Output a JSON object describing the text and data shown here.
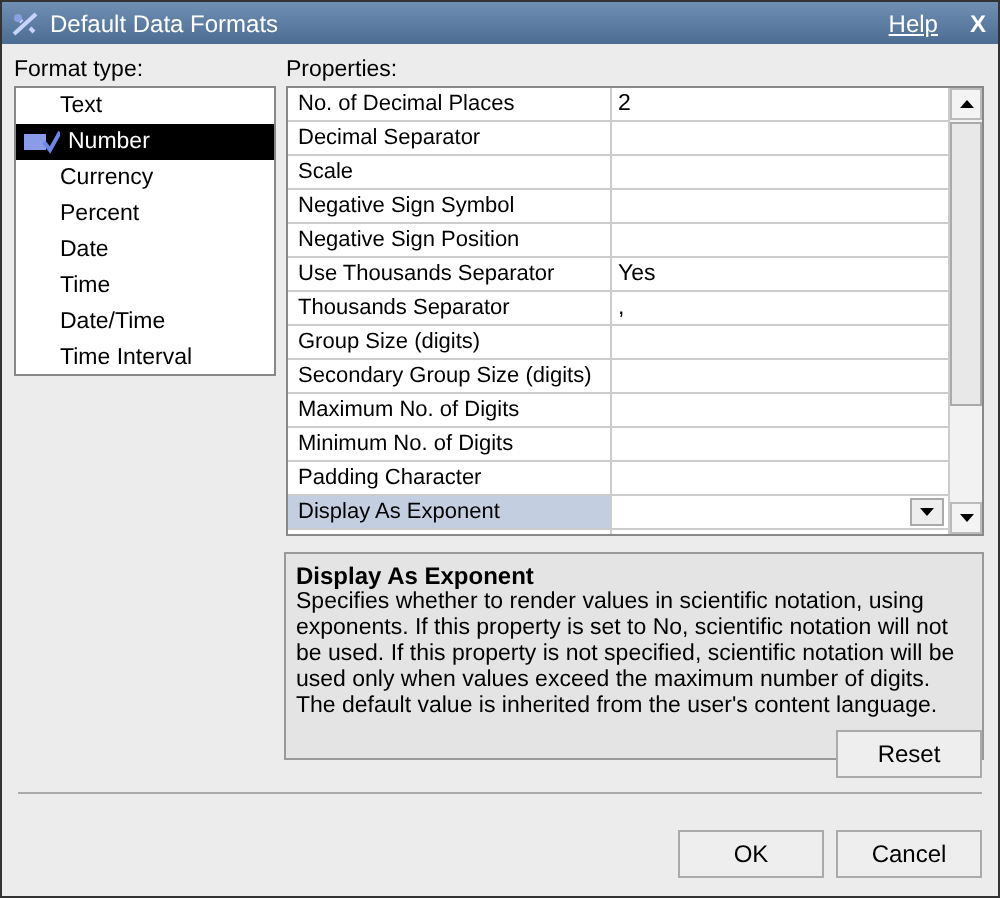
{
  "window": {
    "title": "Default Data Formats",
    "help": "Help",
    "close": "X"
  },
  "format_type": {
    "label": "Format type:",
    "items": [
      {
        "label": "Text",
        "selected": false
      },
      {
        "label": "Number",
        "selected": true
      },
      {
        "label": "Currency",
        "selected": false
      },
      {
        "label": "Percent",
        "selected": false
      },
      {
        "label": "Date",
        "selected": false
      },
      {
        "label": "Time",
        "selected": false
      },
      {
        "label": "Date/Time",
        "selected": false
      },
      {
        "label": "Time Interval",
        "selected": false
      }
    ]
  },
  "properties": {
    "label": "Properties:",
    "rows": [
      {
        "name": "No. of Decimal Places",
        "value": "2",
        "selected": false
      },
      {
        "name": "Decimal Separator",
        "selected": false
      },
      {
        "name": "Scale",
        "selected": false
      },
      {
        "name": "Negative Sign Symbol",
        "selected": false
      },
      {
        "name": "Negative Sign Position",
        "selected": false
      },
      {
        "name": "Use Thousands Separator",
        "value": "Yes",
        "selected": false
      },
      {
        "name": "Thousands Separator",
        "value": ",",
        "selected": false
      },
      {
        "name": "Group Size (digits)",
        "selected": false
      },
      {
        "name": "Secondary Group Size (digits)",
        "selected": false
      },
      {
        "name": "Maximum No. of Digits",
        "selected": false
      },
      {
        "name": "Minimum No. of Digits",
        "selected": false
      },
      {
        "name": "Padding Character",
        "selected": false
      },
      {
        "name": "Display As Exponent",
        "selected": true
      }
    ]
  },
  "description": {
    "title": "Display As Exponent",
    "text": "Specifies whether to render values in scientific notation, using exponents. If this property is set to No, scientific notation will not be used. If this property is not specified, scientific notation will be used only when values exceed the maximum number of digits. The default value is inherited from the user's content language."
  },
  "buttons": {
    "reset": "Reset",
    "ok": "OK",
    "cancel": "Cancel"
  }
}
